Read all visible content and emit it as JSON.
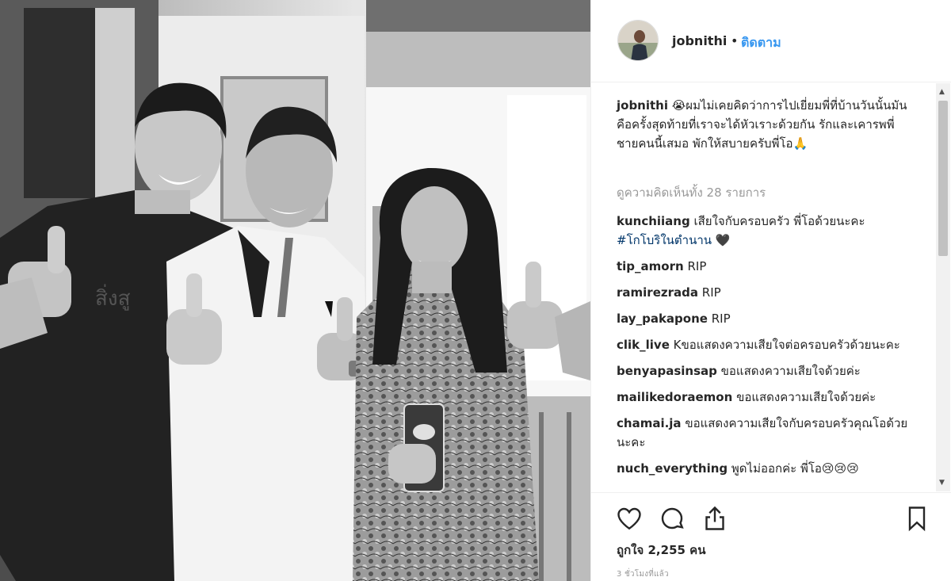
{
  "post": {
    "username": "jobnithi",
    "separator": "•",
    "follow_label": "ติดตาม",
    "caption_username": "jobnithi",
    "caption_text": "😭ผมไม่เคยคิดว่าการไปเยี่ยมพี่ที่บ้านวันนั้นมันคือครั้งสุดท้ายที่เราจะได้หัวเราะด้วยกัน รักและเคารพพี่ชายคนนี้เสมอ พักให้สบายครับพี่โอ🙏",
    "view_all_comments": "ดูความคิดเห็นทั้ง 28 รายการ",
    "likes": "ถูกใจ 2,255 คน",
    "time_ago": "3 ชั่วโมงที่แล้ว"
  },
  "comments": [
    {
      "user": "kunchiiang",
      "text": "เสียใจกับครอบครัว พี่โอด้วยนะคะ",
      "tag": "#โกโบริในตำนาน",
      "emoji": "🖤"
    },
    {
      "user": "tip_amorn",
      "text": "RIP"
    },
    {
      "user": "ramirezrada",
      "text": "RIP"
    },
    {
      "user": "lay_pakapone",
      "text": "RIP"
    },
    {
      "user": "clik_live",
      "text": "Kขอแสดงความเสียใจต่อครอบครัวด้วยนะคะ"
    },
    {
      "user": "benyapasinsap",
      "text": "ขอแสดงความเสียใจด้วยค่ะ"
    },
    {
      "user": "mailikedoraemon",
      "text": "ขอแสดงความเสียใจด้วยค่ะ"
    },
    {
      "user": "chamai.ja",
      "text": "ขอแสดงความเสียใจกับครอบครัวคุณโอด้วยนะคะ"
    },
    {
      "user": "nuch_everything",
      "text": "พูดไม่ออกค่ะ พี่โอ😢😢😢"
    }
  ],
  "icons": {
    "like": "heart-icon",
    "comment": "comment-bubble-icon",
    "share": "share-icon",
    "save": "bookmark-icon"
  },
  "colors": {
    "link": "#3897f0",
    "hashtag": "#003569",
    "muted": "#999999"
  }
}
